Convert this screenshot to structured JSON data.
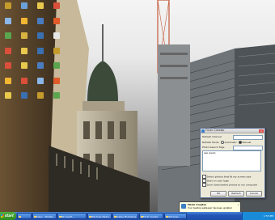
{
  "desktop": {
    "icons": [
      {
        "label": "",
        "color": "#c59b2c"
      },
      {
        "label": "",
        "color": "#6aa0d8"
      },
      {
        "label": "",
        "color": "#e8c84d"
      },
      {
        "label": "",
        "color": "#d94f3a"
      },
      {
        "label": "",
        "color": "#8bb7e8"
      },
      {
        "label": "",
        "color": "#f2b632"
      },
      {
        "label": "",
        "color": "#4a7cc2"
      },
      {
        "label": "",
        "color": "#e05a2a"
      },
      {
        "label": "",
        "color": "#5aa54d"
      },
      {
        "label": "",
        "color": "#d8b340"
      },
      {
        "label": "",
        "color": "#3a6fb0"
      },
      {
        "label": "",
        "color": "#e6e6e6"
      },
      {
        "label": "",
        "color": "#d94f3a"
      },
      {
        "label": "",
        "color": "#e8c84d"
      },
      {
        "label": "",
        "color": "#3a6fb0"
      },
      {
        "label": "",
        "color": "#c59b2c"
      },
      {
        "label": "",
        "color": "#d94f3a"
      },
      {
        "label": "",
        "color": "#e8c84d"
      },
      {
        "label": "",
        "color": "#4a7cc2"
      },
      {
        "label": "",
        "color": "#5aa54d"
      },
      {
        "label": "",
        "color": "#f2b632"
      },
      {
        "label": "",
        "color": "#d94f3a"
      },
      {
        "label": "",
        "color": "#8bb7e8"
      },
      {
        "label": "",
        "color": "#e05a2a"
      },
      {
        "label": "",
        "color": "#e8c84d"
      },
      {
        "label": "",
        "color": "#3a6fb0"
      },
      {
        "label": "",
        "color": "#c59b2c"
      },
      {
        "label": "",
        "color": "#5aa54d"
      }
    ]
  },
  "dialog": {
    "title": "Flickr Creator",
    "close": "×",
    "refresh_interval_label": "Refresh Interval",
    "refresh_mode_label": "Refresh Mode",
    "mode_auto": "Automatic",
    "mode_manual": "Manual",
    "search_tags_label": "Photo Search Tags",
    "search_tags_value": "sao paulo",
    "check1": "Select photos that fit my screen size",
    "check2": "Start on user login",
    "check3": "Save downloaded photos to my computer",
    "ok": "OK",
    "refresh": "Refresh",
    "cancel": "Cancel"
  },
  "balloon": {
    "title": "Flickr Creator",
    "text": "Your desktop wallpaper has been updated",
    "close": "x"
  },
  "taskbar": {
    "start": "start",
    "tasks": [
      "",
      "Inbox - Mozilla...",
      "Microsoft...",
      "Windows Media...",
      "Adobe Photoshop",
      "Flickr Creator",
      "Windows..."
    ],
    "clock": "1:53 PM"
  }
}
